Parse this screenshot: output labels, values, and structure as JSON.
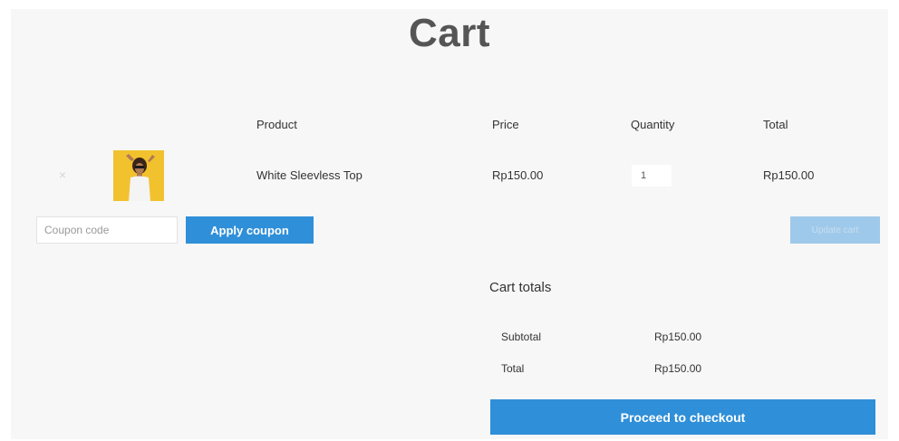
{
  "page": {
    "title": "Cart"
  },
  "table": {
    "headers": {
      "product": "Product",
      "price": "Price",
      "quantity": "Quantity",
      "total": "Total"
    },
    "rows": [
      {
        "remove": "×",
        "product": "White Sleevless Top",
        "price": "Rp150.00",
        "quantity": "1",
        "total": "Rp150.00"
      }
    ]
  },
  "coupon": {
    "placeholder": "Coupon code",
    "apply_label": "Apply coupon"
  },
  "update_cart_label": "Update cart",
  "cart_totals": {
    "title": "Cart totals",
    "subtotal_label": "Subtotal",
    "subtotal_value": "Rp150.00",
    "total_label": "Total",
    "total_value": "Rp150.00",
    "checkout_label": "Proceed to checkout"
  },
  "colors": {
    "accent": "#2f8fd8",
    "accent_disabled": "#9fc9ea",
    "thumb_bg": "#f2c12e"
  }
}
